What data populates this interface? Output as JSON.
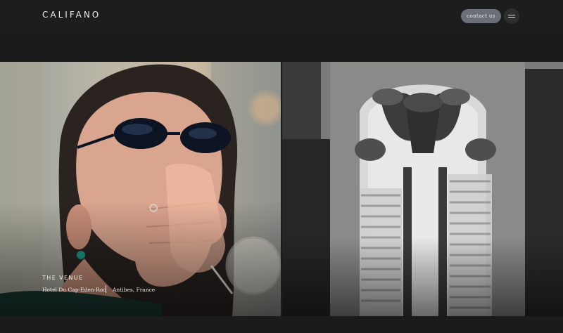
{
  "header": {
    "logo": "CALIFANO",
    "contact_label": "contact us"
  },
  "hero": {
    "label": "THE VENUE",
    "venue_name": "Hotel Du Cap-Eden-Roc",
    "location": "Antibes, France"
  }
}
